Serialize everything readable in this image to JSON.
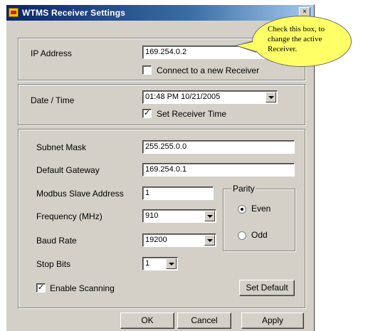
{
  "window": {
    "title": "WTMS Receiver Settings",
    "close_glyph": "×"
  },
  "callout": {
    "text": "Check this box, to change the active Receiver."
  },
  "ip": {
    "label": "IP Address",
    "value": "169.254.0.2",
    "connect_label": "Connect to a new Receiver",
    "connect_checked": false
  },
  "datetime": {
    "label": "Date / Time",
    "value": "01:48 PM  10/21/2005",
    "set_label": "Set Receiver Time",
    "set_checked": true
  },
  "settings": {
    "subnet_label": "Subnet Mask",
    "subnet_value": "255.255.0.0",
    "gateway_label": "Default Gateway",
    "gateway_value": "169.254.0.1",
    "modbus_label": "Modbus Slave Address",
    "modbus_value": "1",
    "frequency_label": "Frequency (MHz)",
    "frequency_value": "910",
    "baud_label": "Baud Rate",
    "baud_value": "19200",
    "stopbits_label": "Stop Bits",
    "stopbits_value": "1",
    "enable_scanning_label": "Enable Scanning",
    "enable_scanning_checked": true,
    "set_default_label": "Set Default"
  },
  "parity": {
    "label": "Parity",
    "even_label": "Even",
    "odd_label": "Odd",
    "selected": "Even"
  },
  "buttons": {
    "ok": "OK",
    "cancel": "Cancel",
    "apply": "Apply"
  },
  "glyphs": {
    "check": "✓"
  }
}
